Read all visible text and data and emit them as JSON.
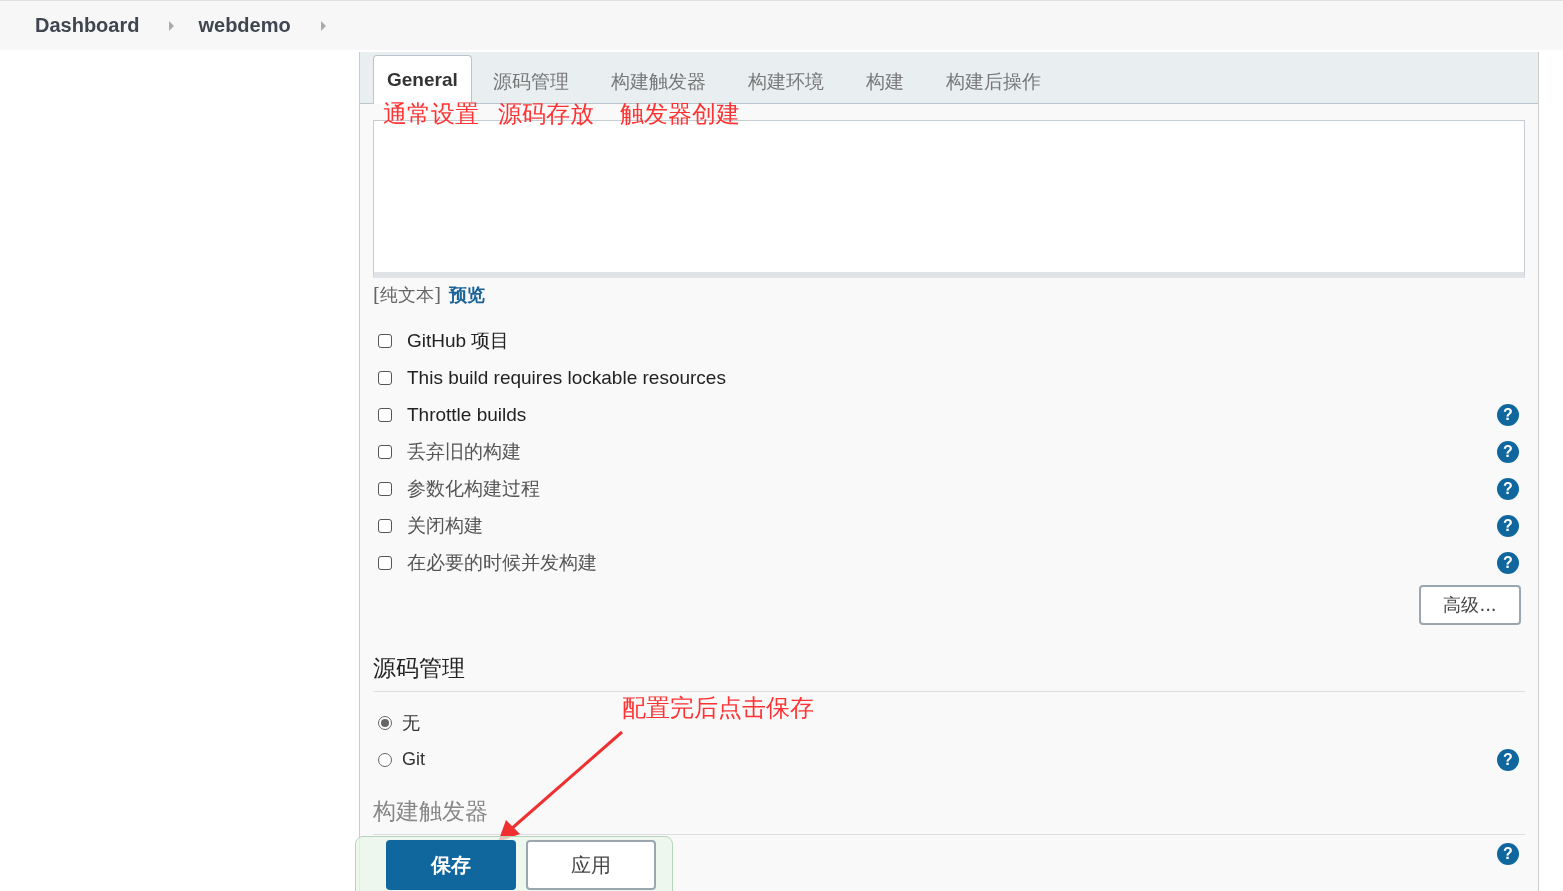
{
  "breadcrumbs": [
    "Dashboard",
    "webdemo"
  ],
  "tabs": [
    {
      "label": "General",
      "selected": true
    },
    {
      "label": "源码管理",
      "selected": false
    },
    {
      "label": "构建触发器",
      "selected": false
    },
    {
      "label": "构建环境",
      "selected": false
    },
    {
      "label": "构建",
      "selected": false
    },
    {
      "label": "构建后操作",
      "selected": false
    }
  ],
  "tab_annotations": [
    "通常设置",
    "源码存放",
    "触发器创建"
  ],
  "description": {
    "format_label": "[纯文本]",
    "preview_link": "预览"
  },
  "options": [
    {
      "label": "GitHub 项目",
      "checked": false
    },
    {
      "label": "This build requires lockable resources",
      "checked": false
    },
    {
      "label": "Throttle builds",
      "checked": false,
      "help": "?"
    },
    {
      "label": "丢弃旧的构建",
      "checked": false,
      "help": "?"
    },
    {
      "label": "参数化构建过程",
      "checked": false,
      "help": "?"
    },
    {
      "label": "关闭构建",
      "checked": false,
      "help": "?"
    },
    {
      "label": "在必要的时候并发构建",
      "checked": false,
      "help": "?"
    }
  ],
  "advanced_button": "高级...",
  "scm": {
    "heading": "源码管理",
    "options": [
      {
        "label": "无",
        "selected": true
      },
      {
        "label": "Git",
        "selected": false,
        "help": "?"
      }
    ]
  },
  "triggers": {
    "heading": "构建触发器",
    "help": "?"
  },
  "save_annotation": "配置完后点击保存",
  "save_button": "保存",
  "apply_button": "应用"
}
